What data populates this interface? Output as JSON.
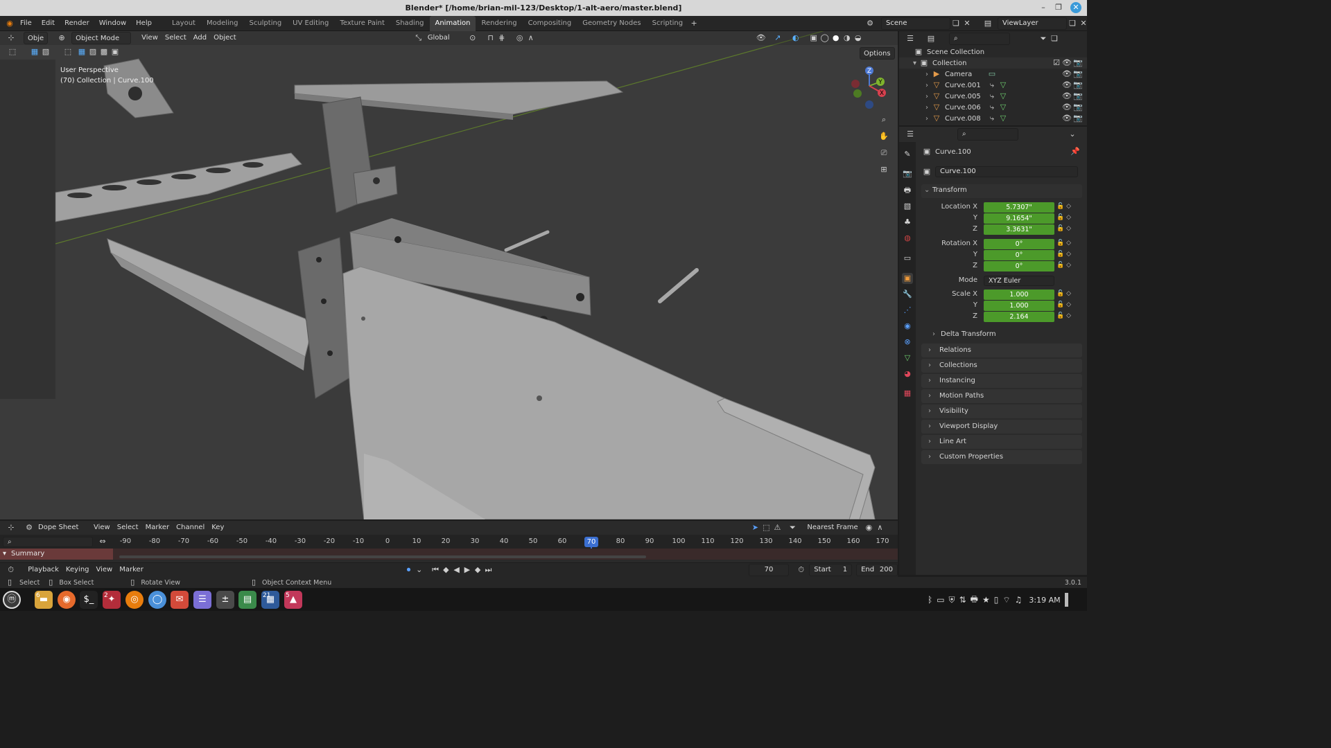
{
  "window": {
    "title": "Blender* [/home/brian-mil-123/Desktop/1-alt-aero/master.blend]"
  },
  "menu": [
    "File",
    "Edit",
    "Render",
    "Window",
    "Help"
  ],
  "workspaces": [
    "Layout",
    "Modeling",
    "Sculpting",
    "UV Editing",
    "Texture Paint",
    "Shading",
    "Animation",
    "Rendering",
    "Compositing",
    "Geometry Nodes",
    "Scripting"
  ],
  "active_workspace": "Animation",
  "scene": "Scene",
  "view_layer": "ViewLayer",
  "viewport": {
    "editor_label": "Obje",
    "mode": "Object Mode",
    "menus": [
      "View",
      "Select",
      "Add",
      "Object"
    ],
    "transform_orientation": "Global",
    "options_label": "Options",
    "info_line1": "User Perspective",
    "info_line2": "(70) Collection | Curve.100",
    "gizmo": {
      "x": "X",
      "y": "Y",
      "z": "Z"
    }
  },
  "outliner": {
    "root": "Scene Collection",
    "collection": "Collection",
    "items": [
      "Camera",
      "Curve.001",
      "Curve.005",
      "Curve.006",
      "Curve.008"
    ]
  },
  "properties": {
    "object_name": "Curve.100",
    "object_field": "Curve.100",
    "transform_label": "Transform",
    "location": {
      "label": "Location X",
      "x": "5.7307\"",
      "y": "9.1654\"",
      "z": "3.3631\""
    },
    "rotation": {
      "label": "Rotation X",
      "x": "0°",
      "y": "0°",
      "z": "0°"
    },
    "mode_label": "Mode",
    "mode_value": "XYZ Euler",
    "scale": {
      "label": "Scale X",
      "x": "1.000",
      "y": "1.000",
      "z": "2.164"
    },
    "axis_y": "Y",
    "axis_z": "Z",
    "subpanels": [
      "Delta Transform",
      "Relations",
      "Collections",
      "Instancing",
      "Motion Paths",
      "Visibility",
      "Viewport Display",
      "Line Art",
      "Custom Properties"
    ]
  },
  "dopesheet": {
    "mode": "Dope Sheet",
    "menus": [
      "View",
      "Select",
      "Marker",
      "Channel",
      "Key"
    ],
    "snap": "Nearest Frame",
    "ticks": [
      "-90",
      "-80",
      "-70",
      "-60",
      "-50",
      "-40",
      "-30",
      "-20",
      "-10",
      "0",
      "10",
      "20",
      "30",
      "40",
      "50",
      "60",
      "70",
      "80",
      "90",
      "100",
      "110",
      "120",
      "130",
      "140",
      "150",
      "160",
      "170"
    ],
    "current_frame": "70",
    "summary": "Summary"
  },
  "timeline": {
    "menus": [
      "Playback",
      "Keying",
      "View",
      "Marker"
    ],
    "current_frame": "70",
    "start_label": "Start",
    "start": "1",
    "end_label": "End",
    "end": "200"
  },
  "status": {
    "select": "Select",
    "box_select": "Box Select",
    "rotate_view": "Rotate View",
    "context_menu": "Object Context Menu",
    "version": "3.0.1"
  },
  "taskbar": {
    "time": "3:19 AM",
    "badge_files": "6",
    "badge_blender": "2",
    "badge_cal": "21",
    "badge_photo": "5"
  },
  "colors": {
    "accent": "#3b6fd1",
    "field_green": "#4c9a2a",
    "active_tab": "#3f3f3f"
  }
}
